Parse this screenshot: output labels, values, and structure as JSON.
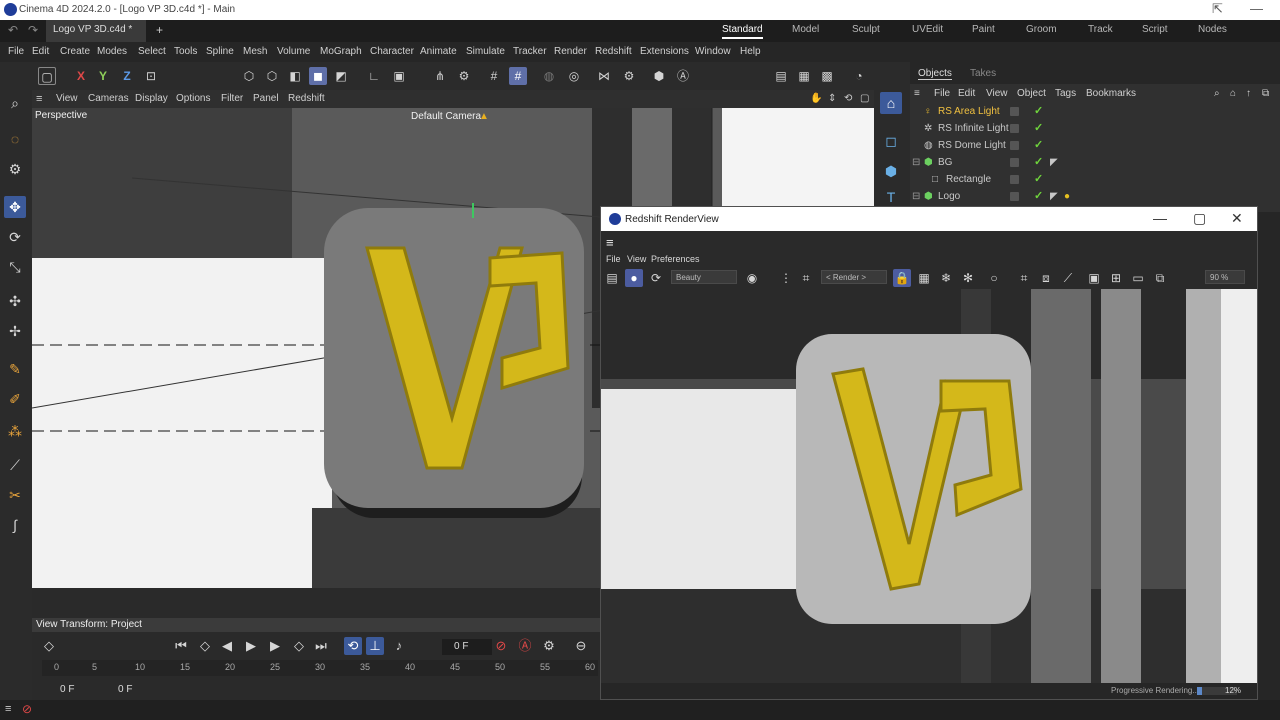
{
  "app": {
    "title": "Cinema 4D 2024.2.0 - [Logo VP 3D.c4d *] - Main",
    "doc_tab": "Logo VP 3D.c4d *",
    "layouts": [
      "Standard",
      "Model",
      "Sculpt",
      "UVEdit",
      "Paint",
      "Groom",
      "Track",
      "Script",
      "Nodes"
    ],
    "active_layout": "Standard"
  },
  "menu": [
    "File",
    "Edit",
    "Create",
    "Modes",
    "Select",
    "Tools",
    "Spline",
    "Mesh",
    "Volume",
    "MoGraph",
    "Character",
    "Animate",
    "Simulate",
    "Tracker",
    "Render",
    "Redshift",
    "Extensions",
    "Window",
    "Help"
  ],
  "toolbar": {
    "x": "X",
    "y": "Y",
    "z": "Z",
    "icons": [
      "object-mode-icon",
      "axis-x",
      "axis-y",
      "axis-z",
      "coord-system-icon",
      "cube-icon",
      "polygon-icon",
      "points-icon",
      "edges-icon",
      "model-mode-icon",
      "texture-icon",
      "snap-icon",
      "workplane-icon",
      "lock-icon",
      "grid-icon",
      "grid-snap-icon",
      "sphere-icon",
      "target-icon",
      "symmetry-icon",
      "gear-icon",
      "deformer-icon",
      "redshift-icon",
      "clapper-icon",
      "render-view-icon",
      "render-settings-icon",
      "dome-icon"
    ]
  },
  "viewport": {
    "menu": [
      "View",
      "Cameras",
      "Display",
      "Options",
      "Filter",
      "Panel",
      "Redshift"
    ],
    "label": "Perspective",
    "camera": "Default Camera",
    "view_transform": "View Transform: Project"
  },
  "objects": {
    "tabs": [
      "Objects",
      "Takes"
    ],
    "menu": [
      "File",
      "Edit",
      "View",
      "Object",
      "Tags",
      "Bookmarks"
    ],
    "rows": [
      {
        "name": "RS Area Light",
        "color": "#f0c040"
      },
      {
        "name": "RS Infinite Light",
        "color": "#d0d0d0"
      },
      {
        "name": "RS Dome Light",
        "color": "#d0d0d0"
      },
      {
        "name": "BG",
        "color": "#d0d0d0"
      },
      {
        "name": "Rectangle",
        "color": "#d0d0d0"
      },
      {
        "name": "Logo",
        "color": "#d0d0d0"
      }
    ]
  },
  "timeline": {
    "frame": "0 F",
    "start": "0 F",
    "current": "0 F",
    "ruler": [
      "0",
      "5",
      "10",
      "15",
      "20",
      "25",
      "30",
      "35",
      "40",
      "45",
      "50",
      "55",
      "60"
    ]
  },
  "renderview": {
    "title": "Redshift RenderView",
    "menu": [
      "File",
      "View",
      "Preferences"
    ],
    "aov": "Beauty",
    "camera": "< Render >",
    "zoom": "90 %",
    "status": "Progressive Rendering...",
    "progress_pct": "12%",
    "progress_fraction": 0.12
  },
  "logo": {
    "letters": "VP",
    "color": "#d4b81a",
    "plate": "#8a8a8a"
  }
}
